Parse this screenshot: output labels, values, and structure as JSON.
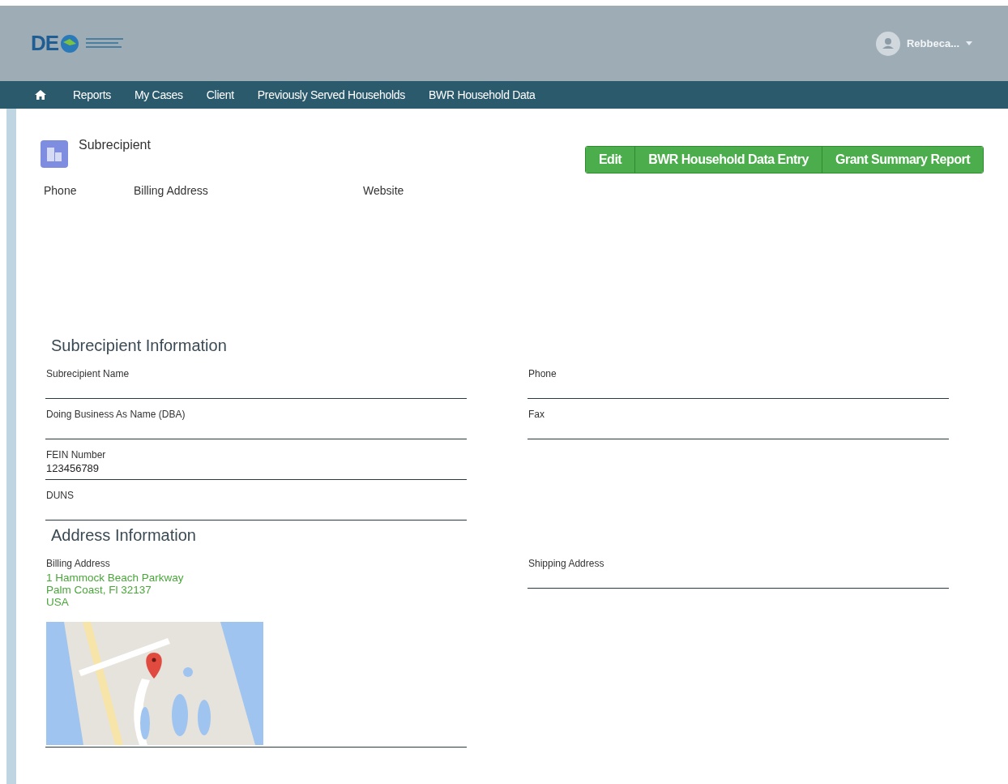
{
  "header": {
    "logo_text": "DE",
    "user_name": "Rebbeca..."
  },
  "nav": {
    "items": [
      "Reports",
      "My Cases",
      "Client",
      "Previously Served Households",
      "BWR Household Data"
    ]
  },
  "record": {
    "type_label": "Subrecipient",
    "buttons": [
      "Edit",
      "BWR Household Data Entry",
      "Grant Summary Report"
    ],
    "highlights": [
      {
        "label": "Phone"
      },
      {
        "label": "Billing Address"
      },
      {
        "label": "Website"
      }
    ]
  },
  "sections": [
    {
      "title": "Subrecipient Information",
      "left": [
        {
          "label": "Subrecipient Name"
        },
        {
          "label": "Doing Business As Name (DBA)"
        },
        {
          "label": "FEIN Number",
          "value": "123456789"
        },
        {
          "label": "DUNS"
        }
      ],
      "right": [
        {
          "label": "Phone"
        },
        {
          "label": "Fax"
        }
      ]
    },
    {
      "title": "Address Information",
      "left": [
        {
          "label": "Billing Address",
          "lines": [
            "1 Hammock Beach Parkway",
            "Palm Coast, Fl 32137",
            "USA"
          ],
          "map": true
        }
      ],
      "right": [
        {
          "label": "Shipping Address"
        }
      ]
    }
  ]
}
